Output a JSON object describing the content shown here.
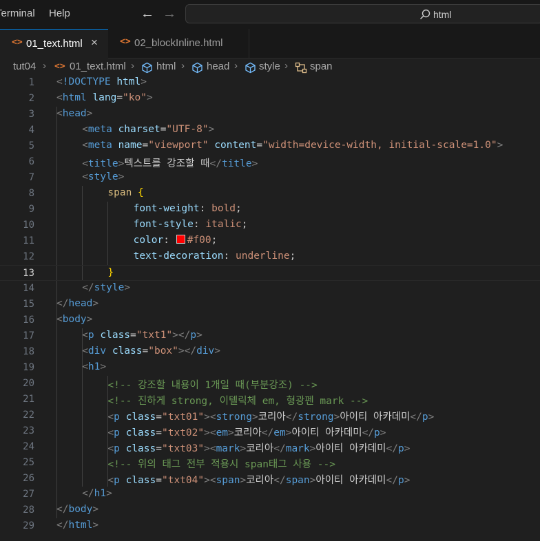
{
  "titlebar": {
    "menu": [
      "Terminal",
      "Help"
    ],
    "search_text": "html"
  },
  "tabs": [
    {
      "label": "01_text.html",
      "icon": "<>",
      "active": true,
      "close": "×"
    },
    {
      "label": "02_blockInline.html",
      "icon": "<>",
      "active": false
    }
  ],
  "breadcrumb": [
    "tut04",
    "01_text.html",
    "html",
    "head",
    "style",
    "span"
  ],
  "editor": {
    "active_line": 13,
    "swatch_color": "#ff0000",
    "lines": [
      {
        "n": 1,
        "indent": 0,
        "tokens": [
          [
            "t-bracket",
            "<"
          ],
          [
            "t-tag",
            "!DOCTYPE "
          ],
          [
            "t-attr",
            "html"
          ],
          [
            "t-bracket",
            ">"
          ]
        ]
      },
      {
        "n": 2,
        "indent": 0,
        "tokens": [
          [
            "t-bracket",
            "<"
          ],
          [
            "t-tag",
            "html "
          ],
          [
            "t-attr",
            "lang"
          ],
          [
            "t-punct",
            "="
          ],
          [
            "t-str",
            "\"ko\""
          ],
          [
            "t-bracket",
            ">"
          ]
        ]
      },
      {
        "n": 3,
        "indent": 0,
        "tokens": [
          [
            "t-bracket",
            "<"
          ],
          [
            "t-tag",
            "head"
          ],
          [
            "t-bracket",
            ">"
          ]
        ]
      },
      {
        "n": 4,
        "indent": 1,
        "tokens": [
          [
            "t-bracket",
            "<"
          ],
          [
            "t-tag",
            "meta "
          ],
          [
            "t-attr",
            "charset"
          ],
          [
            "t-punct",
            "="
          ],
          [
            "t-str",
            "\"UTF-8\""
          ],
          [
            "t-bracket",
            ">"
          ]
        ]
      },
      {
        "n": 5,
        "indent": 1,
        "tokens": [
          [
            "t-bracket",
            "<"
          ],
          [
            "t-tag",
            "meta "
          ],
          [
            "t-attr",
            "name"
          ],
          [
            "t-punct",
            "="
          ],
          [
            "t-str",
            "\"viewport\" "
          ],
          [
            "t-attr",
            "content"
          ],
          [
            "t-punct",
            "="
          ],
          [
            "t-str",
            "\"width=device-width, initial-scale=1.0\""
          ],
          [
            "t-bracket",
            ">"
          ]
        ]
      },
      {
        "n": 6,
        "indent": 1,
        "tokens": [
          [
            "t-bracket",
            "<"
          ],
          [
            "t-tag",
            "title"
          ],
          [
            "t-bracket",
            ">"
          ],
          [
            "t-text",
            "텍스트를 강조할 때"
          ],
          [
            "t-bracket",
            "</"
          ],
          [
            "t-tag",
            "title"
          ],
          [
            "t-bracket",
            ">"
          ]
        ]
      },
      {
        "n": 7,
        "indent": 1,
        "tokens": [
          [
            "t-bracket",
            "<"
          ],
          [
            "t-tag",
            "style"
          ],
          [
            "t-bracket",
            ">"
          ]
        ]
      },
      {
        "n": 8,
        "indent": 2,
        "tokens": [
          [
            "t-sel",
            "span "
          ],
          [
            "t-brace",
            "{"
          ]
        ]
      },
      {
        "n": 9,
        "indent": 3,
        "tokens": [
          [
            "t-prop",
            "font-weight"
          ],
          [
            "t-punct",
            ": "
          ],
          [
            "t-val",
            "bold"
          ],
          [
            "t-punct",
            ";"
          ]
        ]
      },
      {
        "n": 10,
        "indent": 3,
        "tokens": [
          [
            "t-prop",
            "font-style"
          ],
          [
            "t-punct",
            ": "
          ],
          [
            "t-val",
            "italic"
          ],
          [
            "t-punct",
            ";"
          ]
        ]
      },
      {
        "n": 11,
        "indent": 3,
        "tokens": [
          [
            "t-prop",
            "color"
          ],
          [
            "t-punct",
            ": "
          ],
          [
            "swatch",
            ""
          ],
          [
            "t-val",
            "#f00"
          ],
          [
            "t-punct",
            ";"
          ]
        ]
      },
      {
        "n": 12,
        "indent": 3,
        "tokens": [
          [
            "t-prop",
            "text-decoration"
          ],
          [
            "t-punct",
            ": "
          ],
          [
            "t-val",
            "underline"
          ],
          [
            "t-punct",
            ";"
          ]
        ]
      },
      {
        "n": 13,
        "indent": 2,
        "tokens": [
          [
            "t-brace",
            "}"
          ]
        ]
      },
      {
        "n": 14,
        "indent": 1,
        "tokens": [
          [
            "t-bracket",
            "</"
          ],
          [
            "t-tag",
            "style"
          ],
          [
            "t-bracket",
            ">"
          ]
        ]
      },
      {
        "n": 15,
        "indent": 0,
        "tokens": [
          [
            "t-bracket",
            "</"
          ],
          [
            "t-tag",
            "head"
          ],
          [
            "t-bracket",
            ">"
          ]
        ]
      },
      {
        "n": 16,
        "indent": 0,
        "tokens": [
          [
            "t-bracket",
            "<"
          ],
          [
            "t-tag",
            "body"
          ],
          [
            "t-bracket",
            ">"
          ]
        ]
      },
      {
        "n": 17,
        "indent": 1,
        "tokens": [
          [
            "t-bracket",
            "<"
          ],
          [
            "t-tag",
            "p "
          ],
          [
            "t-attr",
            "class"
          ],
          [
            "t-punct",
            "="
          ],
          [
            "t-str",
            "\"txt1\""
          ],
          [
            "t-bracket",
            "></"
          ],
          [
            "t-tag",
            "p"
          ],
          [
            "t-bracket",
            ">"
          ]
        ]
      },
      {
        "n": 18,
        "indent": 1,
        "tokens": [
          [
            "t-bracket",
            "<"
          ],
          [
            "t-tag",
            "div "
          ],
          [
            "t-attr",
            "class"
          ],
          [
            "t-punct",
            "="
          ],
          [
            "t-str",
            "\"box\""
          ],
          [
            "t-bracket",
            "></"
          ],
          [
            "t-tag",
            "div"
          ],
          [
            "t-bracket",
            ">"
          ]
        ]
      },
      {
        "n": 19,
        "indent": 1,
        "tokens": [
          [
            "t-bracket",
            "<"
          ],
          [
            "t-tag",
            "h1"
          ],
          [
            "t-bracket",
            ">"
          ]
        ]
      },
      {
        "n": 20,
        "indent": 2,
        "tokens": [
          [
            "t-comment",
            "<!-- 강조할 내용이 1개일 때(부분강조) -->"
          ]
        ]
      },
      {
        "n": 21,
        "indent": 2,
        "tokens": [
          [
            "t-comment",
            "<!-- 진하게 strong, 이텔릭체 em, 형광펜 mark -->"
          ]
        ]
      },
      {
        "n": 22,
        "indent": 2,
        "tokens": [
          [
            "t-bracket",
            "<"
          ],
          [
            "t-tag",
            "p "
          ],
          [
            "t-attr",
            "class"
          ],
          [
            "t-punct",
            "="
          ],
          [
            "t-str",
            "\"txt01\""
          ],
          [
            "t-bracket",
            "><"
          ],
          [
            "t-tag",
            "strong"
          ],
          [
            "t-bracket",
            ">"
          ],
          [
            "t-text",
            "코리아"
          ],
          [
            "t-bracket",
            "</"
          ],
          [
            "t-tag",
            "strong"
          ],
          [
            "t-bracket",
            ">"
          ],
          [
            "t-text",
            "아이티 아카데미"
          ],
          [
            "t-bracket",
            "</"
          ],
          [
            "t-tag",
            "p"
          ],
          [
            "t-bracket",
            ">"
          ]
        ]
      },
      {
        "n": 23,
        "indent": 2,
        "tokens": [
          [
            "t-bracket",
            "<"
          ],
          [
            "t-tag",
            "p "
          ],
          [
            "t-attr",
            "class"
          ],
          [
            "t-punct",
            "="
          ],
          [
            "t-str",
            "\"txt02\""
          ],
          [
            "t-bracket",
            "><"
          ],
          [
            "t-tag",
            "em"
          ],
          [
            "t-bracket",
            ">"
          ],
          [
            "t-text",
            "코리아"
          ],
          [
            "t-bracket",
            "</"
          ],
          [
            "t-tag",
            "em"
          ],
          [
            "t-bracket",
            ">"
          ],
          [
            "t-text",
            "아이티 아카데미"
          ],
          [
            "t-bracket",
            "</"
          ],
          [
            "t-tag",
            "p"
          ],
          [
            "t-bracket",
            ">"
          ]
        ]
      },
      {
        "n": 24,
        "indent": 2,
        "tokens": [
          [
            "t-bracket",
            "<"
          ],
          [
            "t-tag",
            "p "
          ],
          [
            "t-attr",
            "class"
          ],
          [
            "t-punct",
            "="
          ],
          [
            "t-str",
            "\"txt03\""
          ],
          [
            "t-bracket",
            "><"
          ],
          [
            "t-tag",
            "mark"
          ],
          [
            "t-bracket",
            ">"
          ],
          [
            "t-text",
            "코리아"
          ],
          [
            "t-bracket",
            "</"
          ],
          [
            "t-tag",
            "mark"
          ],
          [
            "t-bracket",
            ">"
          ],
          [
            "t-text",
            "아이티 아카데미"
          ],
          [
            "t-bracket",
            "</"
          ],
          [
            "t-tag",
            "p"
          ],
          [
            "t-bracket",
            ">"
          ]
        ]
      },
      {
        "n": 25,
        "indent": 2,
        "tokens": [
          [
            "t-comment",
            "<!-- 위의 태그 전부 적용시 span태그 사용 -->"
          ]
        ]
      },
      {
        "n": 26,
        "indent": 2,
        "tokens": [
          [
            "t-bracket",
            "<"
          ],
          [
            "t-tag",
            "p "
          ],
          [
            "t-attr",
            "class"
          ],
          [
            "t-punct",
            "="
          ],
          [
            "t-str",
            "\"txt04\""
          ],
          [
            "t-bracket",
            "><"
          ],
          [
            "t-tag",
            "span"
          ],
          [
            "t-bracket",
            ">"
          ],
          [
            "t-text",
            "코리아"
          ],
          [
            "t-bracket",
            "</"
          ],
          [
            "t-tag",
            "span"
          ],
          [
            "t-bracket",
            ">"
          ],
          [
            "t-text",
            "아이티 아카데미"
          ],
          [
            "t-bracket",
            "</"
          ],
          [
            "t-tag",
            "p"
          ],
          [
            "t-bracket",
            ">"
          ]
        ]
      },
      {
        "n": 27,
        "indent": 1,
        "tokens": [
          [
            "t-bracket",
            "</"
          ],
          [
            "t-tag",
            "h1"
          ],
          [
            "t-bracket",
            ">"
          ]
        ]
      },
      {
        "n": 28,
        "indent": 0,
        "tokens": [
          [
            "t-bracket",
            "</"
          ],
          [
            "t-tag",
            "body"
          ],
          [
            "t-bracket",
            ">"
          ]
        ]
      },
      {
        "n": 29,
        "indent": 0,
        "tokens": [
          [
            "t-bracket",
            "</"
          ],
          [
            "t-tag",
            "html"
          ],
          [
            "t-bracket",
            ">"
          ]
        ]
      }
    ]
  }
}
